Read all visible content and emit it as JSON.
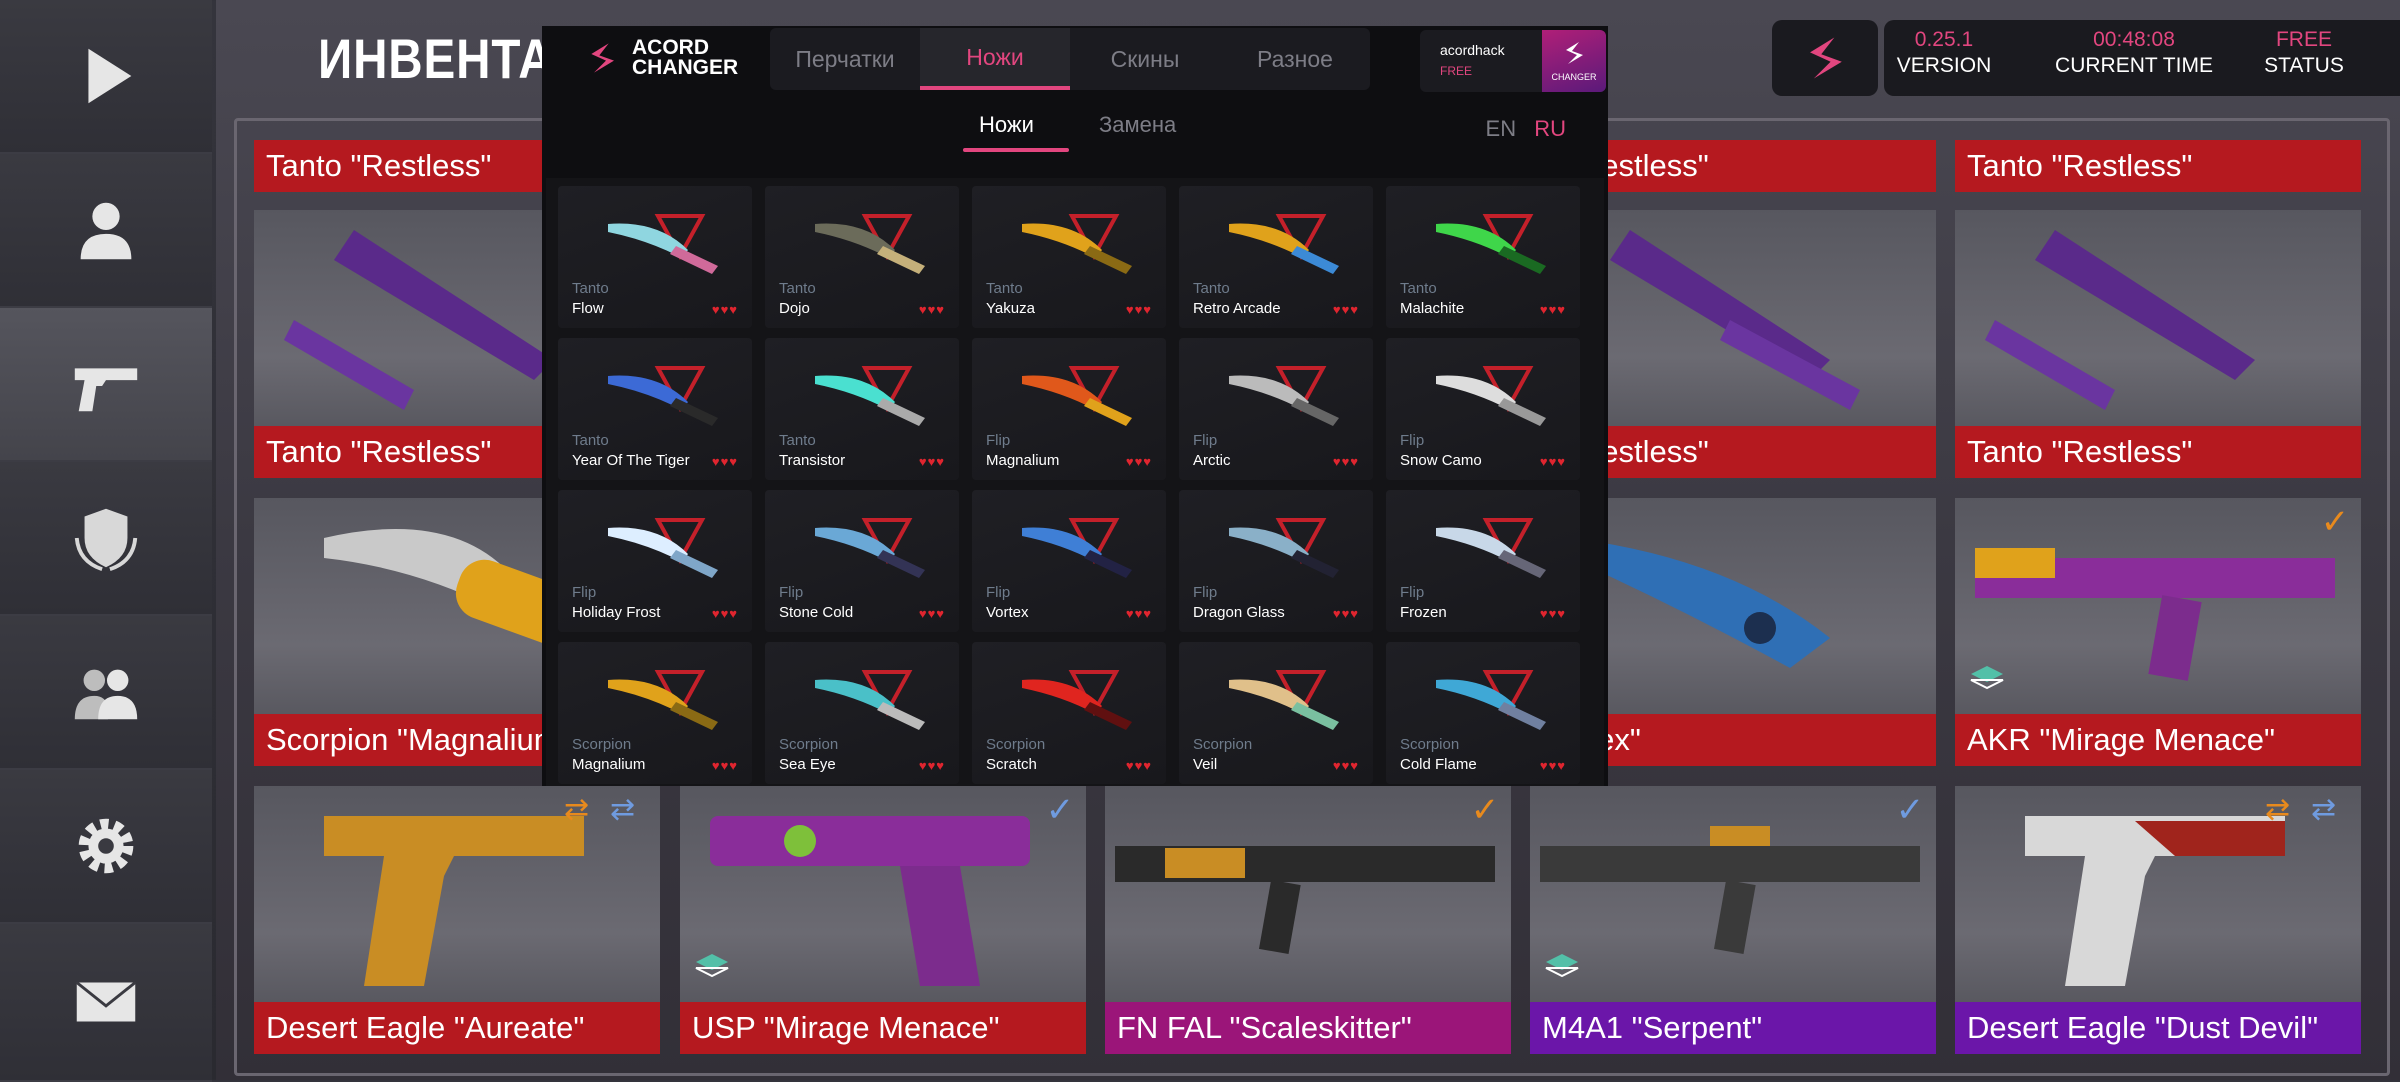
{
  "sidebar": {
    "items": [
      {
        "icon": "play-icon"
      },
      {
        "icon": "profile-icon"
      },
      {
        "icon": "pistol-icon"
      },
      {
        "icon": "shield-laurel-icon"
      },
      {
        "icon": "friends-icon"
      },
      {
        "icon": "gear-icon"
      },
      {
        "icon": "mail-icon"
      }
    ]
  },
  "inventory": {
    "title": "ИНВЕНТАРЬ",
    "top_strips": [
      "Tanto \"Restless\"",
      "o \"Restless\"",
      "Tanto \"Restless\""
    ],
    "cards": [
      {
        "label": "Tanto \"Restless\"",
        "color": "red"
      },
      {
        "label": "o \"Restless\"",
        "color": "red"
      },
      {
        "label": "Tanto \"Restless\"",
        "color": "red"
      },
      {
        "label": "Scorpion \"Magnalium",
        "color": "red"
      },
      {
        "label": "Vortex\"",
        "color": "red"
      },
      {
        "label": "AKR \"Mirage Menace\"",
        "color": "red"
      },
      {
        "label": "Desert Eagle \"Aureate\"",
        "color": "red"
      },
      {
        "label": "USP \"Mirage Menace\"",
        "color": "red"
      },
      {
        "label": "FN FAL \"Scaleskitter\"",
        "color": "pink"
      },
      {
        "label": "M4A1 \"Serpent\"",
        "color": "purple"
      },
      {
        "label": "Desert Eagle \"Dust Devil\"",
        "color": "purple"
      }
    ]
  },
  "status_bar": {
    "version_value": "0.25.1",
    "version_label": "VERSION",
    "time_value": "00:48:08",
    "time_label": "CURRENT TIME",
    "status_value": "FREE",
    "status_label": "STATUS"
  },
  "modal": {
    "logo_line1": "ACORD",
    "logo_line2": "CHANGER",
    "tabs": [
      "Перчатки",
      "Ножи",
      "Скины",
      "Разное"
    ],
    "active_tab": "Ножи",
    "user_name": "acordhack",
    "user_plan": "FREE",
    "user_badge": "CHANGER",
    "subtabs": [
      "Ножи",
      "Замена"
    ],
    "lang_en": "EN",
    "lang_ru": "RU",
    "knives": [
      {
        "type": "Tanto",
        "name": "Flow"
      },
      {
        "type": "Tanto",
        "name": "Dojo"
      },
      {
        "type": "Tanto",
        "name": "Yakuza"
      },
      {
        "type": "Tanto",
        "name": "Retro Arcade"
      },
      {
        "type": "Tanto",
        "name": "Malachite"
      },
      {
        "type": "Tanto",
        "name": "Year Of The Tiger"
      },
      {
        "type": "Tanto",
        "name": "Transistor"
      },
      {
        "type": "Flip",
        "name": "Magnalium"
      },
      {
        "type": "Flip",
        "name": "Arctic"
      },
      {
        "type": "Flip",
        "name": "Snow Camo"
      },
      {
        "type": "Flip",
        "name": "Holiday Frost"
      },
      {
        "type": "Flip",
        "name": "Stone Cold"
      },
      {
        "type": "Flip",
        "name": "Vortex"
      },
      {
        "type": "Flip",
        "name": "Dragon Glass"
      },
      {
        "type": "Flip",
        "name": "Frozen"
      },
      {
        "type": "Scorpion",
        "name": "Magnalium"
      },
      {
        "type": "Scorpion",
        "name": "Sea Eye"
      },
      {
        "type": "Scorpion",
        "name": "Scratch"
      },
      {
        "type": "Scorpion",
        "name": "Veil"
      },
      {
        "type": "Scorpion",
        "name": "Cold Flame"
      }
    ],
    "hearts": "♥♥♥"
  },
  "colors": {
    "accent": "#e2467f",
    "label_red": "#b5191f",
    "label_pink": "#9b1579",
    "label_purple": "#6b16a9"
  }
}
